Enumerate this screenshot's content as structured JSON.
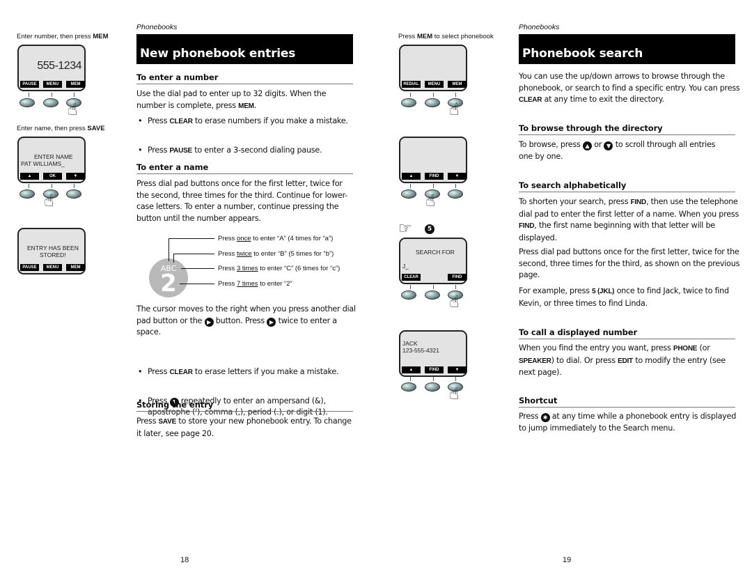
{
  "left_page": {
    "section_label": "Phonebooks",
    "title": "New phonebook entries",
    "sections": {
      "enter_number": {
        "heading": "To enter a number",
        "para_pre": "Use the dial pad to enter up to 32 digits. When the number is complete, press ",
        "para_kw": "MEM",
        "para_post": ".",
        "bullets": [
          {
            "pre": "Press ",
            "kw": "CLEAR",
            "post": " to erase numbers if you make a mistake."
          },
          {
            "pre": "Press ",
            "kw": "PAUSE",
            "post": " to enter a 3-second dialing pause."
          }
        ]
      },
      "enter_name": {
        "heading": "To enter a name",
        "para": "Press dial pad buttons once for the first letter, twice for the second, three times for the third. Continue for lower-case letters. To enter a number, continue pressing the button until the number appears.",
        "dial_key": {
          "letters": "ABC",
          "digit": "2"
        },
        "dial_notes": [
          {
            "pre": "Press ",
            "u": "once",
            "post": " to enter “A” (4 times for “a”)"
          },
          {
            "pre": "Press ",
            "u": "twice",
            "post": " to enter “B” (5 times for “b”)"
          },
          {
            "pre": "Press ",
            "u": "3 times",
            "post": " to enter “C” (6 times for “c”)"
          },
          {
            "pre": "Press ",
            "u": "7 times",
            "post": " to enter “2”"
          }
        ],
        "cursor_para_1": "The cursor moves to the right when you press another dial pad button or the ",
        "cursor_para_2": " button. Press ",
        "cursor_para_3": " twice to enter a space.",
        "bullets": [
          {
            "pre": "Press ",
            "kw": "CLEAR",
            "post": " to erase letters if you make a mistake."
          },
          {
            "pre": "Press ",
            "icon_text": "1",
            "post": " repeatedly to enter an ampersand (&), apostrophe ('), comma (,), period (.), or digit (1)."
          }
        ]
      },
      "storing": {
        "heading": "Storing the entry",
        "pre": "Press ",
        "kw": "SAVE",
        "post": " to store your new phonebook entry. To change it later, see page 20."
      }
    },
    "figures": [
      {
        "caption_pre": "Enter number, then press ",
        "caption_kw": "MEM",
        "lines": [
          "555-1234"
        ],
        "softkeys": [
          "PAUSE",
          "MENU",
          "MEM"
        ],
        "pressed": 3
      },
      {
        "caption_pre": "Enter name, then press ",
        "caption_kw": "SAVE",
        "lines": [
          "ENTER NAME",
          "PAT WILLIAMS_"
        ],
        "softkeys": [
          "▲",
          "OK",
          "▼"
        ],
        "pressed": 2
      },
      {
        "lines": [
          "ENTRY HAS BEEN",
          "STORED!"
        ],
        "softkeys": [
          "PAUSE",
          "MENU",
          "MEM"
        ]
      }
    ],
    "page_number": "18"
  },
  "right_page": {
    "section_label": "Phonebooks",
    "title": "Phonebook search",
    "intro_pre": "You can use the up/down arrows to browse through the phonebook, or search to find a specific entry. You can press ",
    "intro_kw": "CLEAR",
    "intro_post": " at any time to exit the directory.",
    "sections": {
      "browse": {
        "heading": "To browse through the directory",
        "p1": "To browse, press ",
        "p2": " or ",
        "p3": " to scroll through all entries one by one."
      },
      "alpha": {
        "heading": "To search alphabetically",
        "p1_a": "To shorten your search, press ",
        "p1_kw1": "FIND",
        "p1_b": ", then use the telephone dial pad to enter the first letter of a name. When you press ",
        "p1_kw2": "FIND",
        "p1_c": ", the first name beginning with that letter will be displayed.",
        "p2": "Press dial pad buttons once for the first letter, twice for the second, three times for the third, as shown on the previous page.",
        "p3_a": "For example, press ",
        "p3_kw": "5 (JKL)",
        "p3_b": " once to find Jack, twice to find Kevin, or three times to find Linda."
      },
      "call": {
        "heading": "To call a displayed number",
        "a": "When you find the entry you want, press ",
        "kw1": "PHONE",
        "b": " (or ",
        "kw2": "SPEAKER",
        "c": ") to dial. Or press ",
        "kw3": "EDIT",
        "d": " to modify the entry (see next page)."
      },
      "shortcut": {
        "heading": "Shortcut",
        "a": "Press ",
        "b": " at any time while a phonebook entry is displayed to jump immediately to the Search menu."
      }
    },
    "figures": [
      {
        "caption_pre": "Press ",
        "caption_kw": "MEM",
        "caption_post": " to select phonebook",
        "lines": [],
        "softkeys": [
          "REDIAL",
          "MENU",
          "MEM"
        ],
        "pressed": 3
      },
      {
        "lines": [],
        "softkeys": [
          "▲",
          "FIND",
          "▼"
        ],
        "pressed": 2
      },
      {
        "key_hint": "5",
        "lines": [
          "SEARCH FOR",
          "J_"
        ],
        "softkeys": [
          "CLEAR",
          "",
          "FIND"
        ],
        "pressed": 3
      },
      {
        "lines": [
          "JACK",
          "123-555-4321"
        ],
        "softkeys": [
          "▲",
          "FIND",
          "▼"
        ],
        "pressed": 3
      }
    ],
    "page_number": "19"
  },
  "icons": {
    "right_arrow_button": "▶",
    "up_button": "▲",
    "down_button": "▼",
    "star_button": "✱",
    "pointing_hand": "☞",
    "pressing_hand": "☝"
  }
}
